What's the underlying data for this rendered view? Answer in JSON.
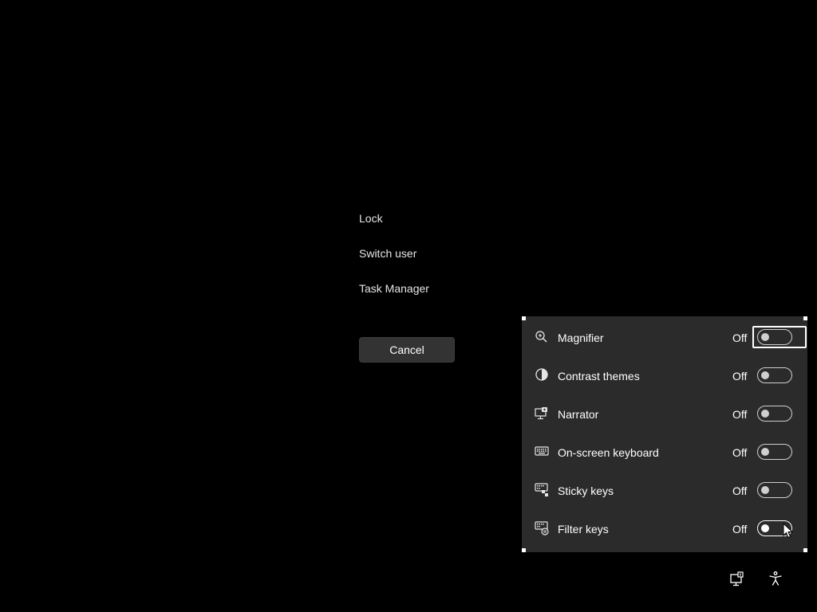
{
  "menu": {
    "lock": "Lock",
    "switch_user": "Switch user",
    "task_manager": "Task Manager",
    "cancel": "Cancel"
  },
  "accessibility": {
    "items": [
      {
        "label": "Magnifier",
        "state": "Off",
        "icon": "magnifier-icon",
        "focused": true
      },
      {
        "label": "Contrast themes",
        "state": "Off",
        "icon": "contrast-icon",
        "focused": false
      },
      {
        "label": "Narrator",
        "state": "Off",
        "icon": "narrator-icon",
        "focused": false
      },
      {
        "label": "On-screen keyboard",
        "state": "Off",
        "icon": "keyboard-icon",
        "focused": false
      },
      {
        "label": "Sticky keys",
        "state": "Off",
        "icon": "sticky-keys-icon",
        "focused": false
      },
      {
        "label": "Filter keys",
        "state": "Off",
        "icon": "filter-keys-icon",
        "focused": false
      }
    ]
  },
  "tray": {
    "icons": [
      "network-icon",
      "accessibility-icon"
    ]
  },
  "colors": {
    "background": "#000000",
    "flyout": "#2b2b2b",
    "button": "#333333"
  }
}
